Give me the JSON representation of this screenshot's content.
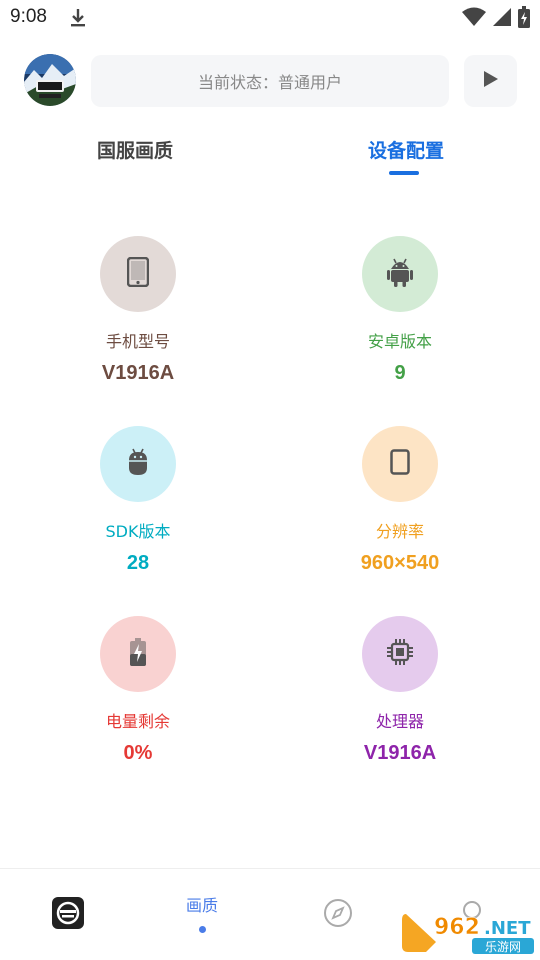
{
  "statusbar": {
    "time": "9:08"
  },
  "header": {
    "status_text": "当前状态：普通用户"
  },
  "tabs": [
    {
      "label": "国服画质",
      "active": false
    },
    {
      "label": "设备配置",
      "active": true
    }
  ],
  "info": {
    "phone_model": {
      "label": "手机型号",
      "value": "V1916A",
      "color": "#6d4c41",
      "bg": "#e3dad7",
      "icon": "phone-icon"
    },
    "android_version": {
      "label": "安卓版本",
      "value": "9",
      "color": "#43a047",
      "bg": "#d3ebd5",
      "icon": "android-icon"
    },
    "sdk_version": {
      "label": "SDK版本",
      "value": "28",
      "color": "#00acc1",
      "bg": "#ccf0f7",
      "icon": "sdk-icon"
    },
    "resolution": {
      "label": "分辨率",
      "value": "960×540",
      "color": "#f0a020",
      "bg": "#fde4c5",
      "icon": "screen-icon"
    },
    "battery": {
      "label": "电量剩余",
      "value": "0%",
      "color": "#e53935",
      "bg": "#f9d2d1",
      "icon": "battery-icon"
    },
    "processor": {
      "label": "处理器",
      "value": "V1916A",
      "color": "#8e24aa",
      "bg": "#e5cbed",
      "icon": "chip-icon"
    }
  },
  "bottom_nav": {
    "quality_label": "画质"
  },
  "watermark": {
    "text_top": "962.NET",
    "text_bottom": "乐游网"
  }
}
